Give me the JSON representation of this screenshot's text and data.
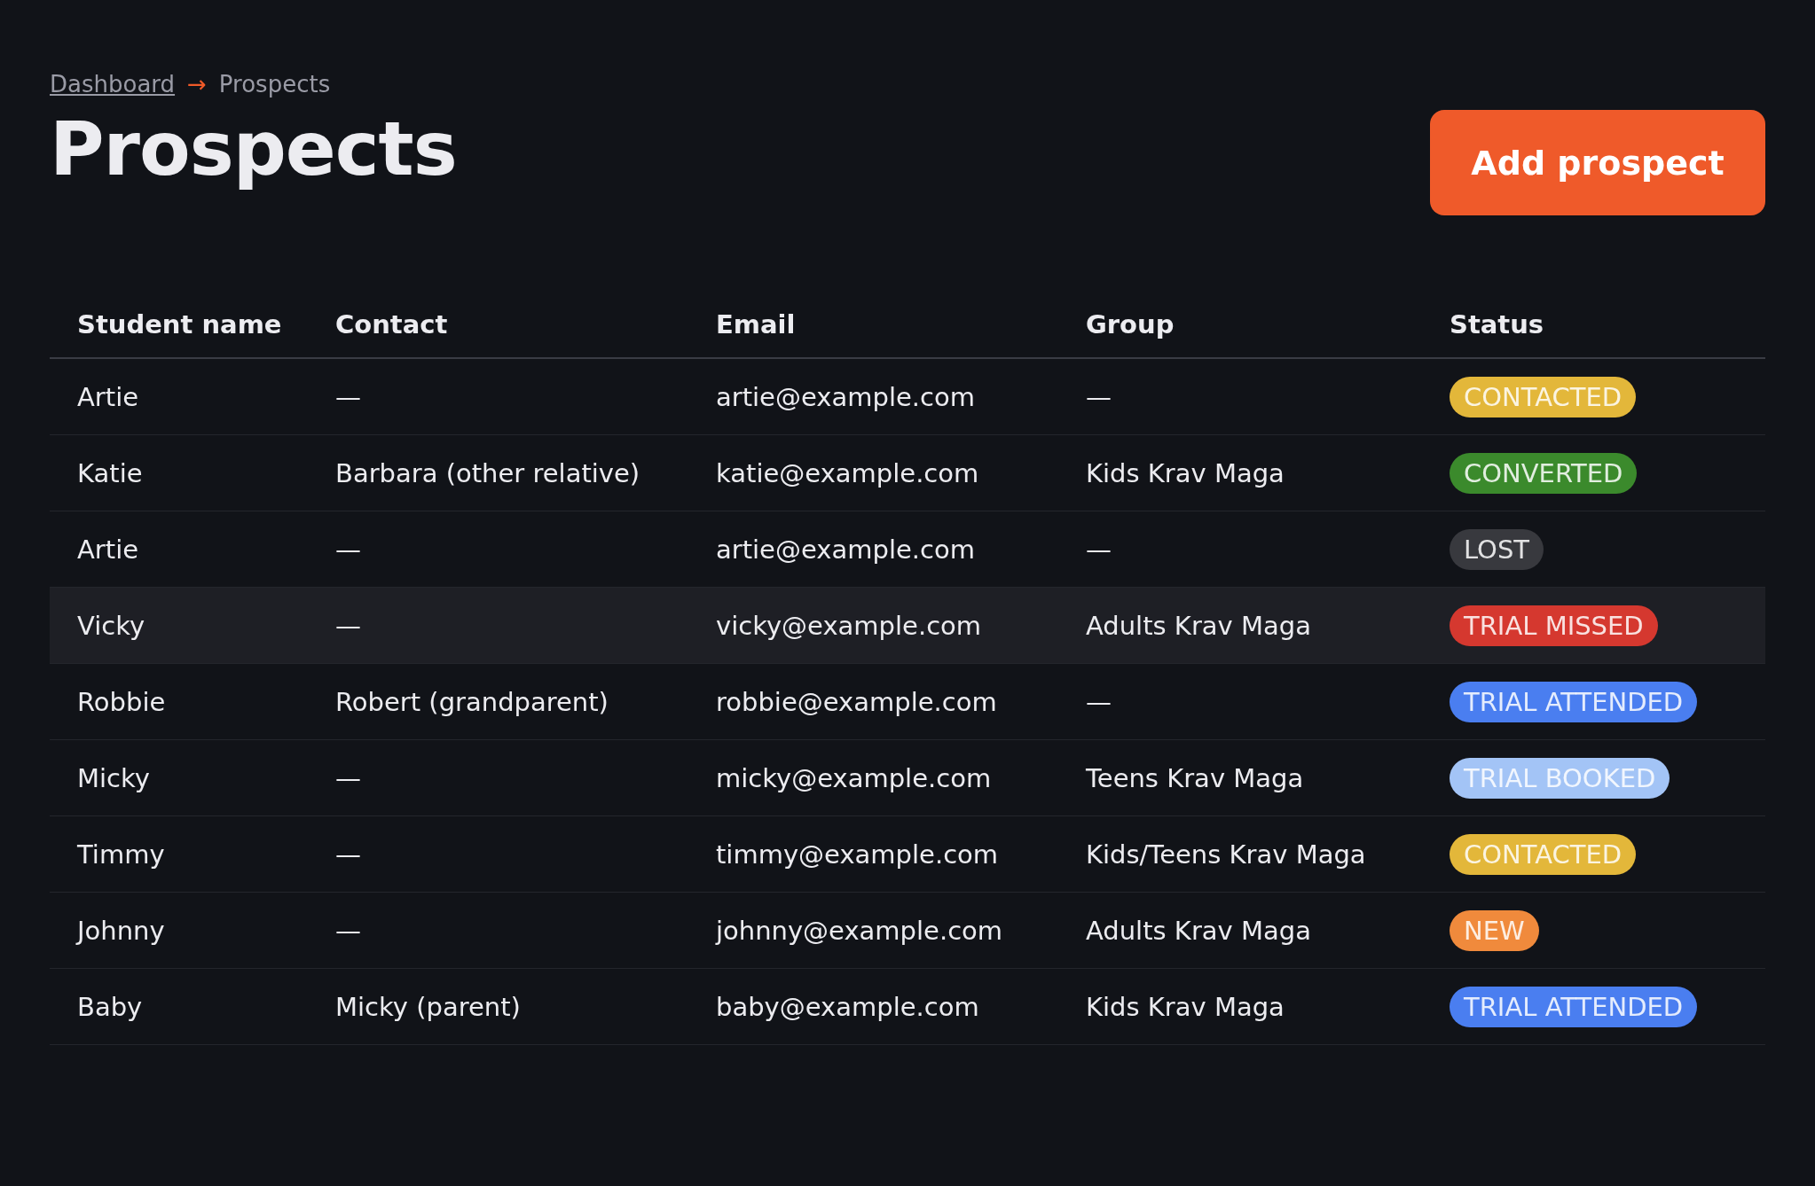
{
  "breadcrumb": [
    {
      "label": "Dashboard",
      "kind": "link"
    },
    {
      "label": "→",
      "kind": "separator"
    },
    {
      "label": "Prospects",
      "kind": "current"
    }
  ],
  "title": "Prospects",
  "add_button": "Add prospect",
  "table": {
    "columns": [
      "Student name",
      "Contact",
      "Email",
      "Group",
      "Status"
    ],
    "rows": [
      {
        "name": "Artie",
        "contact": "—",
        "email": "artie@example.com",
        "group": "—",
        "status": {
          "label": "CONTACTED",
          "color": "#e3b73a"
        },
        "selected": false
      },
      {
        "name": "Katie",
        "contact": "Barbara (other relative)",
        "email": "katie@example.com",
        "group": "Kids Krav Maga",
        "status": {
          "label": "CONVERTED",
          "color": "#3b8a2c"
        },
        "selected": false
      },
      {
        "name": "Artie",
        "contact": "—",
        "email": "artie@example.com",
        "group": "—",
        "status": {
          "label": "LOST",
          "color": "#38393e"
        },
        "selected": false
      },
      {
        "name": "Vicky",
        "contact": "—",
        "email": "vicky@example.com",
        "group": "Adults Krav Maga",
        "status": {
          "label": "TRIAL MISSED",
          "color": "#d5382f"
        },
        "selected": true
      },
      {
        "name": "Robbie",
        "contact": "Robert (grandparent)",
        "email": "robbie@example.com",
        "group": "—",
        "status": {
          "label": "TRIAL ATTENDED",
          "color": "#4a7ef0"
        },
        "selected": false
      },
      {
        "name": "Micky",
        "contact": "—",
        "email": "micky@example.com",
        "group": "Teens Krav Maga",
        "status": {
          "label": "TRIAL BOOKED",
          "color": "#a3c4f6"
        },
        "selected": false
      },
      {
        "name": "Timmy",
        "contact": "—",
        "email": "timmy@example.com",
        "group": "Kids/Teens Krav Maga",
        "status": {
          "label": "CONTACTED",
          "color": "#e3b73a"
        },
        "selected": false
      },
      {
        "name": "Johnny",
        "contact": "—",
        "email": "johnny@example.com",
        "group": "Adults Krav Maga",
        "status": {
          "label": "NEW",
          "color": "#f08a3c"
        },
        "selected": false
      },
      {
        "name": "Baby",
        "contact": "Micky (parent)",
        "email": "baby@example.com",
        "group": "Kids Krav Maga",
        "status": {
          "label": "TRIAL ATTENDED",
          "color": "#4a7ef0"
        },
        "selected": false
      }
    ]
  }
}
